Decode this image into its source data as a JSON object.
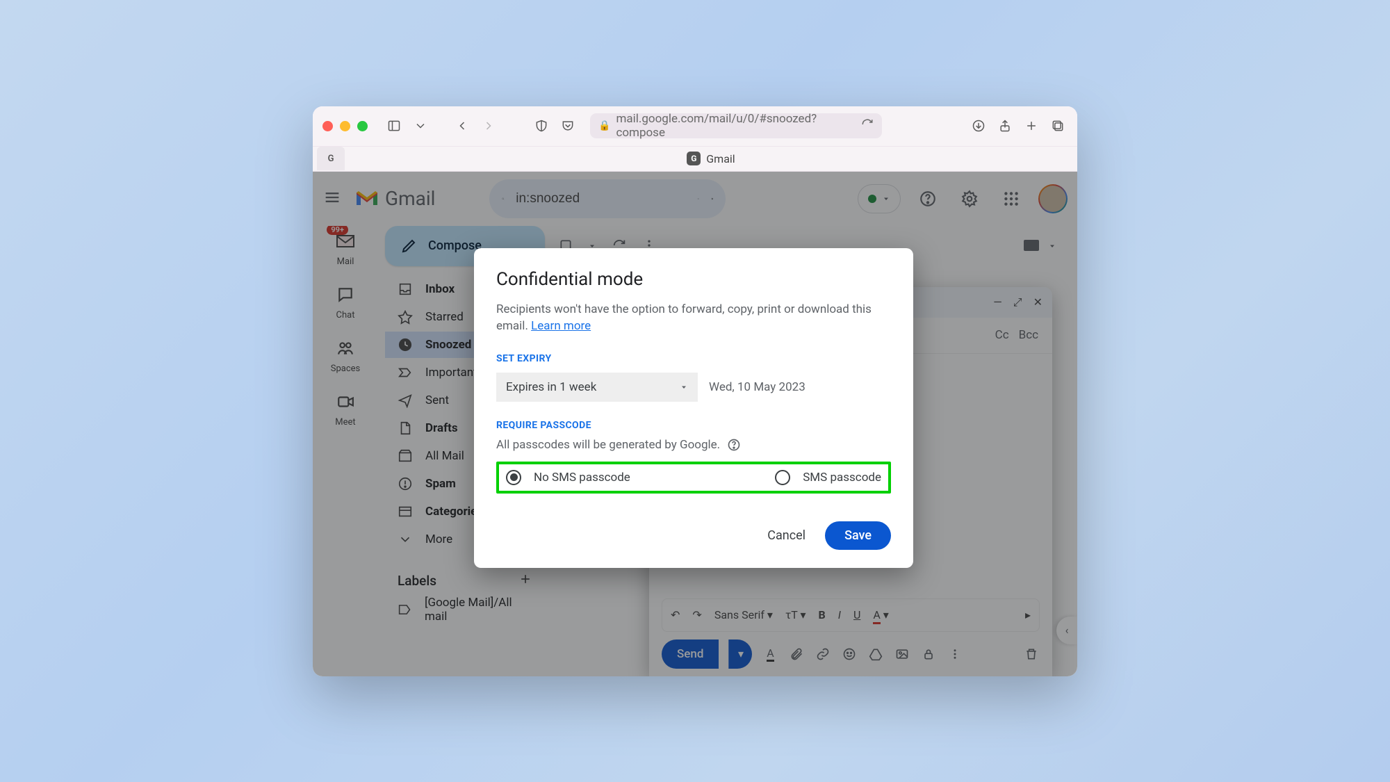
{
  "browser": {
    "url": "mail.google.com/mail/u/0/#snoozed?compose",
    "tab_badge": "G",
    "tab_title": "Gmail"
  },
  "gmail": {
    "brand": "Gmail",
    "search_value": "in:snoozed",
    "rail": {
      "mail": "Mail",
      "mail_badge": "99+",
      "chat": "Chat",
      "spaces": "Spaces",
      "meet": "Meet"
    },
    "compose_label": "Compose",
    "nav": {
      "inbox": "Inbox",
      "starred": "Starred",
      "snoozed": "Snoozed",
      "important": "Important",
      "sent": "Sent",
      "drafts": "Drafts",
      "allmail": "All Mail",
      "spam": "Spam",
      "categories": "Categories",
      "more": "More"
    },
    "labels_header": "Labels",
    "label_allmail": "[Google Mail]/All mail"
  },
  "compose_win": {
    "cc": "Cc",
    "bcc": "Bcc",
    "font": "Sans Serif",
    "send": "Send"
  },
  "modal": {
    "title": "Confidential mode",
    "body": "Recipients won't have the option to forward, copy, print or download this email. ",
    "learn": "Learn more",
    "set_expiry": "SET EXPIRY",
    "expiry_value": "Expires in 1 week",
    "expiry_date": "Wed, 10 May 2023",
    "require_passcode": "REQUIRE PASSCODE",
    "passcode_desc": "All passcodes will be generated by Google.",
    "opt_no_sms": "No SMS passcode",
    "opt_sms": "SMS passcode",
    "cancel": "Cancel",
    "save": "Save"
  }
}
